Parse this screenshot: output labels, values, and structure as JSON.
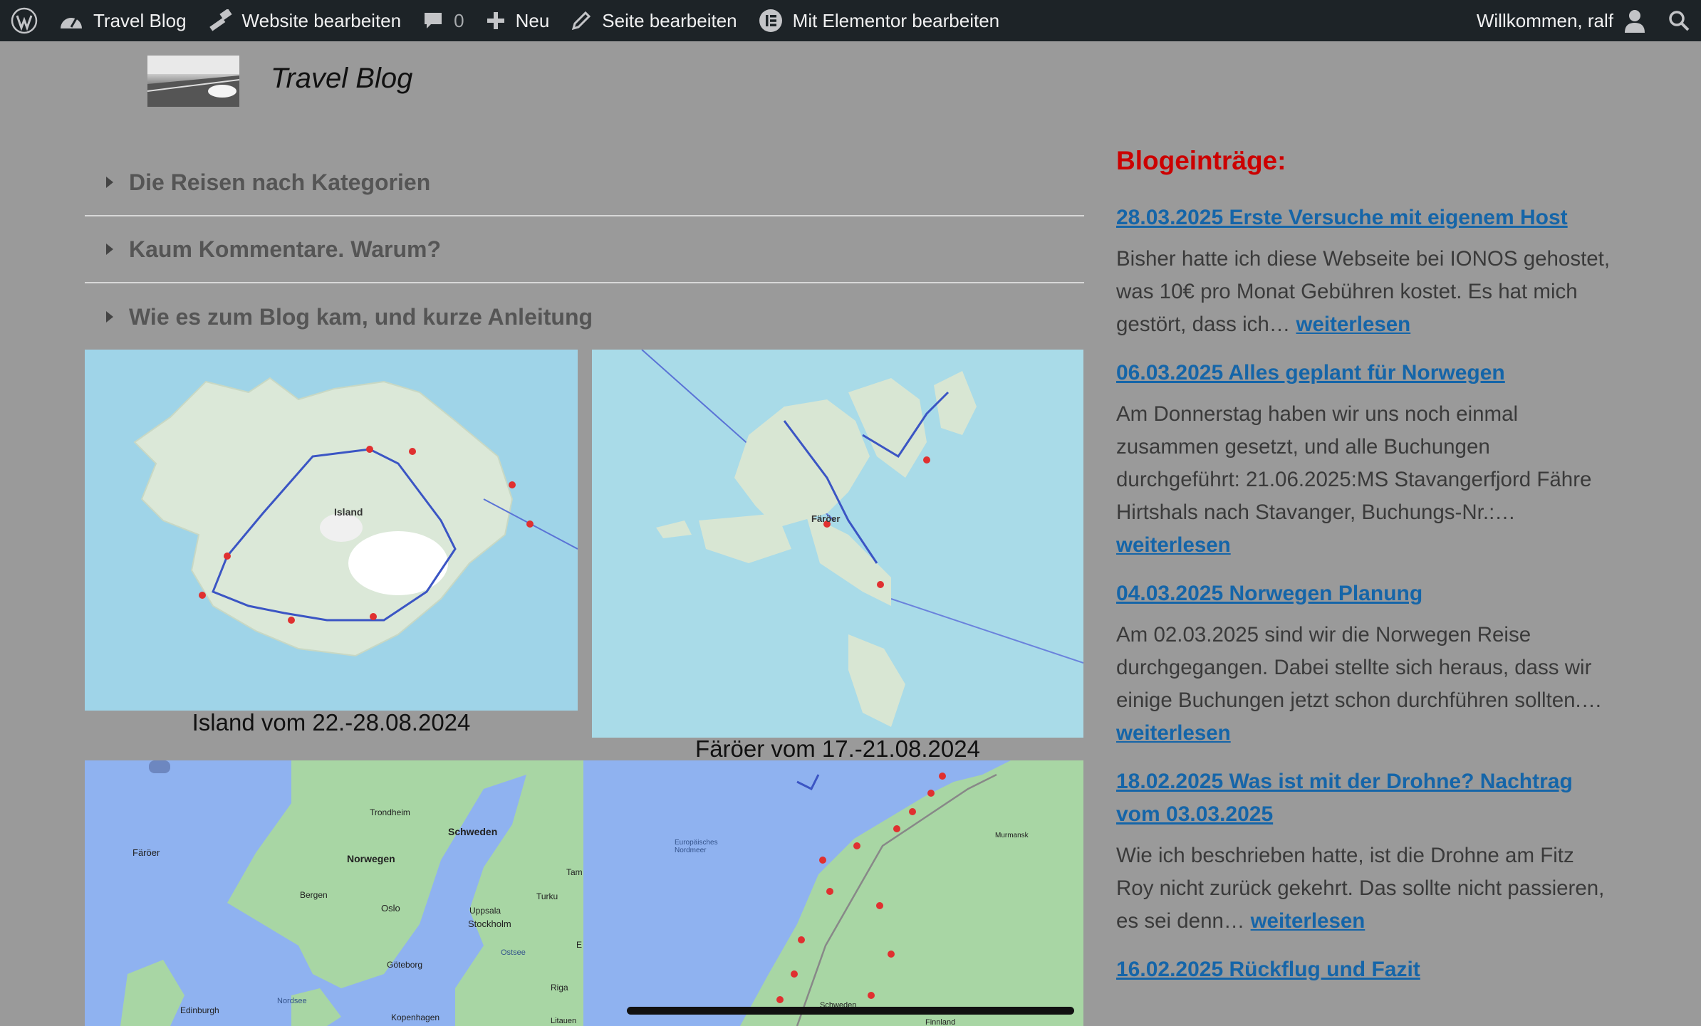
{
  "adminbar": {
    "site_name": "Travel Blog",
    "edit_website": "Website bearbeiten",
    "comments_count": "0",
    "new_label": "Neu",
    "edit_page": "Seite bearbeiten",
    "elementor": "Mit Elementor bearbeiten",
    "welcome": "Willkommen, ralf"
  },
  "header": {
    "site_title": "Travel Blog"
  },
  "accordion": [
    {
      "label": "Die Reisen nach Kategorien"
    },
    {
      "label": "Kaum Kommentare. Warum?"
    },
    {
      "label": "Wie es zum Blog kam, und kurze Anleitung"
    }
  ],
  "maps": {
    "island": {
      "caption": "Island vom 22.-28.08.2024",
      "label": "Island"
    },
    "faroer": {
      "caption": "Färöer vom 17.-21.08.2024",
      "label": "Färöer"
    },
    "scandinavia": {
      "labels": [
        "Färöer",
        "Trondheim",
        "Schweden",
        "Norwegen",
        "Bergen",
        "Oslo",
        "Uppsala",
        "Stockholm",
        "Göteborg",
        "Ostsee",
        "Nordsee",
        "Edinburgh",
        "Kopenhagen",
        "Riga",
        "Tam",
        "Turku",
        "E",
        "Litauen"
      ]
    },
    "norway": {
      "labels": [
        "Europäisches Nordmeer",
        "Murmansk",
        "Schweden",
        "Finnland"
      ]
    }
  },
  "sidebar": {
    "heading": "Blogeinträge:",
    "read_more": "weiterlesen",
    "posts": [
      {
        "title": "28.03.2025 Erste Versuche mit eigenem Host",
        "excerpt": "Bisher hatte ich diese Webseite bei IONOS gehostet, was 10€ pro Monat Gebühren kostet. Es hat mich gestört, dass ich…"
      },
      {
        "title": "06.03.2025 Alles geplant für Norwegen",
        "excerpt": "Am Donnerstag haben wir uns noch einmal zusammen gesetzt, und alle Buchungen durchgeführt: 21.06.2025:MS Stavangerfjord Fähre Hirtshals nach Stavanger, Buchungs-Nr.:…"
      },
      {
        "title": "04.03.2025 Norwegen Planung",
        "excerpt": "Am 02.03.2025 sind wir die Norwegen Reise durchgegangen. Dabei stellte sich heraus, dass wir einige Buchungen jetzt schon durchführen sollten.…"
      },
      {
        "title": "18.02.2025 Was ist mit der Drohne? Nachtrag vom 03.03.2025",
        "excerpt": "Wie ich beschrieben hatte, ist die Drohne am Fitz Roy nicht zurück gekehrt. Das sollte nicht passieren, es sei denn…"
      },
      {
        "title": "16.02.2025 Rückflug und Fazit",
        "excerpt": ""
      }
    ]
  },
  "colors": {
    "adminbar_bg": "#1d2327",
    "page_bg": "#9a9a9a",
    "heading_red": "#cc0000",
    "link_blue": "#1565a8",
    "sea_light": "#9fd4e8",
    "sea_google": "#8fb2f0"
  }
}
